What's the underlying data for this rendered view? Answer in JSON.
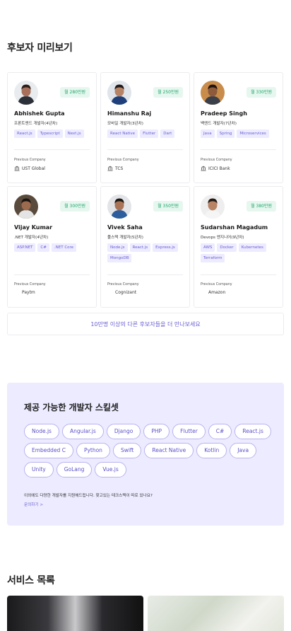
{
  "sections": {
    "preview_title": "후보자 미리보기",
    "services_title": "서비스 목록"
  },
  "candidates": [
    {
      "name": "Abhishek Gupta",
      "role": "프론트엔드 개발자(4년차)",
      "salary": "월 280만원",
      "tags": [
        "React.js",
        "Typescript",
        "Next.js"
      ],
      "previous_company_label": "Previous Company",
      "company": "UST Global",
      "company_icon": "bank-icon",
      "avatar_colors": {
        "bg": "#e9ecef",
        "skin": "#a8705a",
        "hair": "#2b1d16",
        "shirt": "#2b2f38"
      }
    },
    {
      "name": "Himanshu Raj",
      "role": "모바일 개발자(3년차)",
      "salary": "월 250만원",
      "tags": [
        "React Native",
        "Flutter",
        "Dart"
      ],
      "previous_company_label": "Previous Company",
      "company": "TCS",
      "company_icon": "bank-icon",
      "avatar_colors": {
        "bg": "#dfe5ea",
        "skin": "#b78366",
        "hair": "#1f1a18",
        "shirt": "#1e3f7a"
      }
    },
    {
      "name": "Pradeep Singh",
      "role": "백엔드 개발자(7년차)",
      "salary": "월 330만원",
      "tags": [
        "Java",
        "Spring",
        "Microservices"
      ],
      "previous_company_label": "Previous Company",
      "company": "ICICI Bank",
      "company_icon": "bank-icon",
      "avatar_colors": {
        "bg": "#c98c4b",
        "skin": "#8d5a3b",
        "hair": "#1c1410",
        "shirt": "#3a3f4a"
      }
    },
    {
      "name": "Vijay Kumar",
      ".role_note": "",
      "role": ".NET 개발자(4년차)",
      "salary": "월 300만원",
      "tags": [
        "ASP.NET",
        "C#",
        ".NET Core"
      ],
      "previous_company_label": "Previous Company",
      "company": "Paytm",
      "company_icon": "none",
      "avatar_colors": {
        "bg": "#5a4a3c",
        "skin": "#9c6a4d",
        "hair": "#1b1411",
        "shirt": "#e4e4e4"
      }
    },
    {
      "name": "Vivek Saha",
      "role": "풀스택 개발자(5년차)",
      "salary": "월 350만원",
      "tags": [
        "Node.js",
        "React.js",
        "Express.js",
        "MongoDB"
      ],
      "previous_company_label": "Previous Company",
      "company": "Cognizant",
      "company_icon": "none",
      "avatar_colors": {
        "bg": "#e2e4e8",
        "skin": "#a97457",
        "hair": "#1e1815",
        "shirt": "#2c5d9c"
      }
    },
    {
      "name": "Sudarshan Magadum",
      "role": "Devops 엔지니어(9년차)",
      "salary": "월 380만원",
      "tags": [
        "AWS",
        "Docker",
        "Kubernetes",
        "Terraform"
      ],
      "previous_company_label": "Previous Company",
      "company": "Amazon",
      "company_icon": "none",
      "avatar_colors": {
        "bg": "#eeeeee",
        "skin": "#b88465",
        "hair": "#241a15",
        "shirt": "#f5f5f5"
      }
    }
  ],
  "more_candidates": "10만명 이상의 다른 후보자들을 더 만나보세요",
  "skills": {
    "title": "제공 가능한 개발자 스킬셋",
    "items": [
      "Node.js",
      "Angular.js",
      "Django",
      "PHP",
      "Flutter",
      "C#",
      "React.js",
      "Embedded C",
      "Python",
      "Swift",
      "React Native",
      "Kotlin",
      "Java",
      "Unity",
      "GoLang",
      "Vue.js"
    ],
    "note": "이외에도 다양한 개발자를 지원해드립니다. 찾고있는 테크스택이 따로 있나요?",
    "link": "문의하기 >"
  },
  "colors": {
    "accent": "#6a5fd0",
    "salary_bg": "#e6f7ef",
    "salary_text": "#1ea56a",
    "skills_bg": "#ecebff"
  }
}
